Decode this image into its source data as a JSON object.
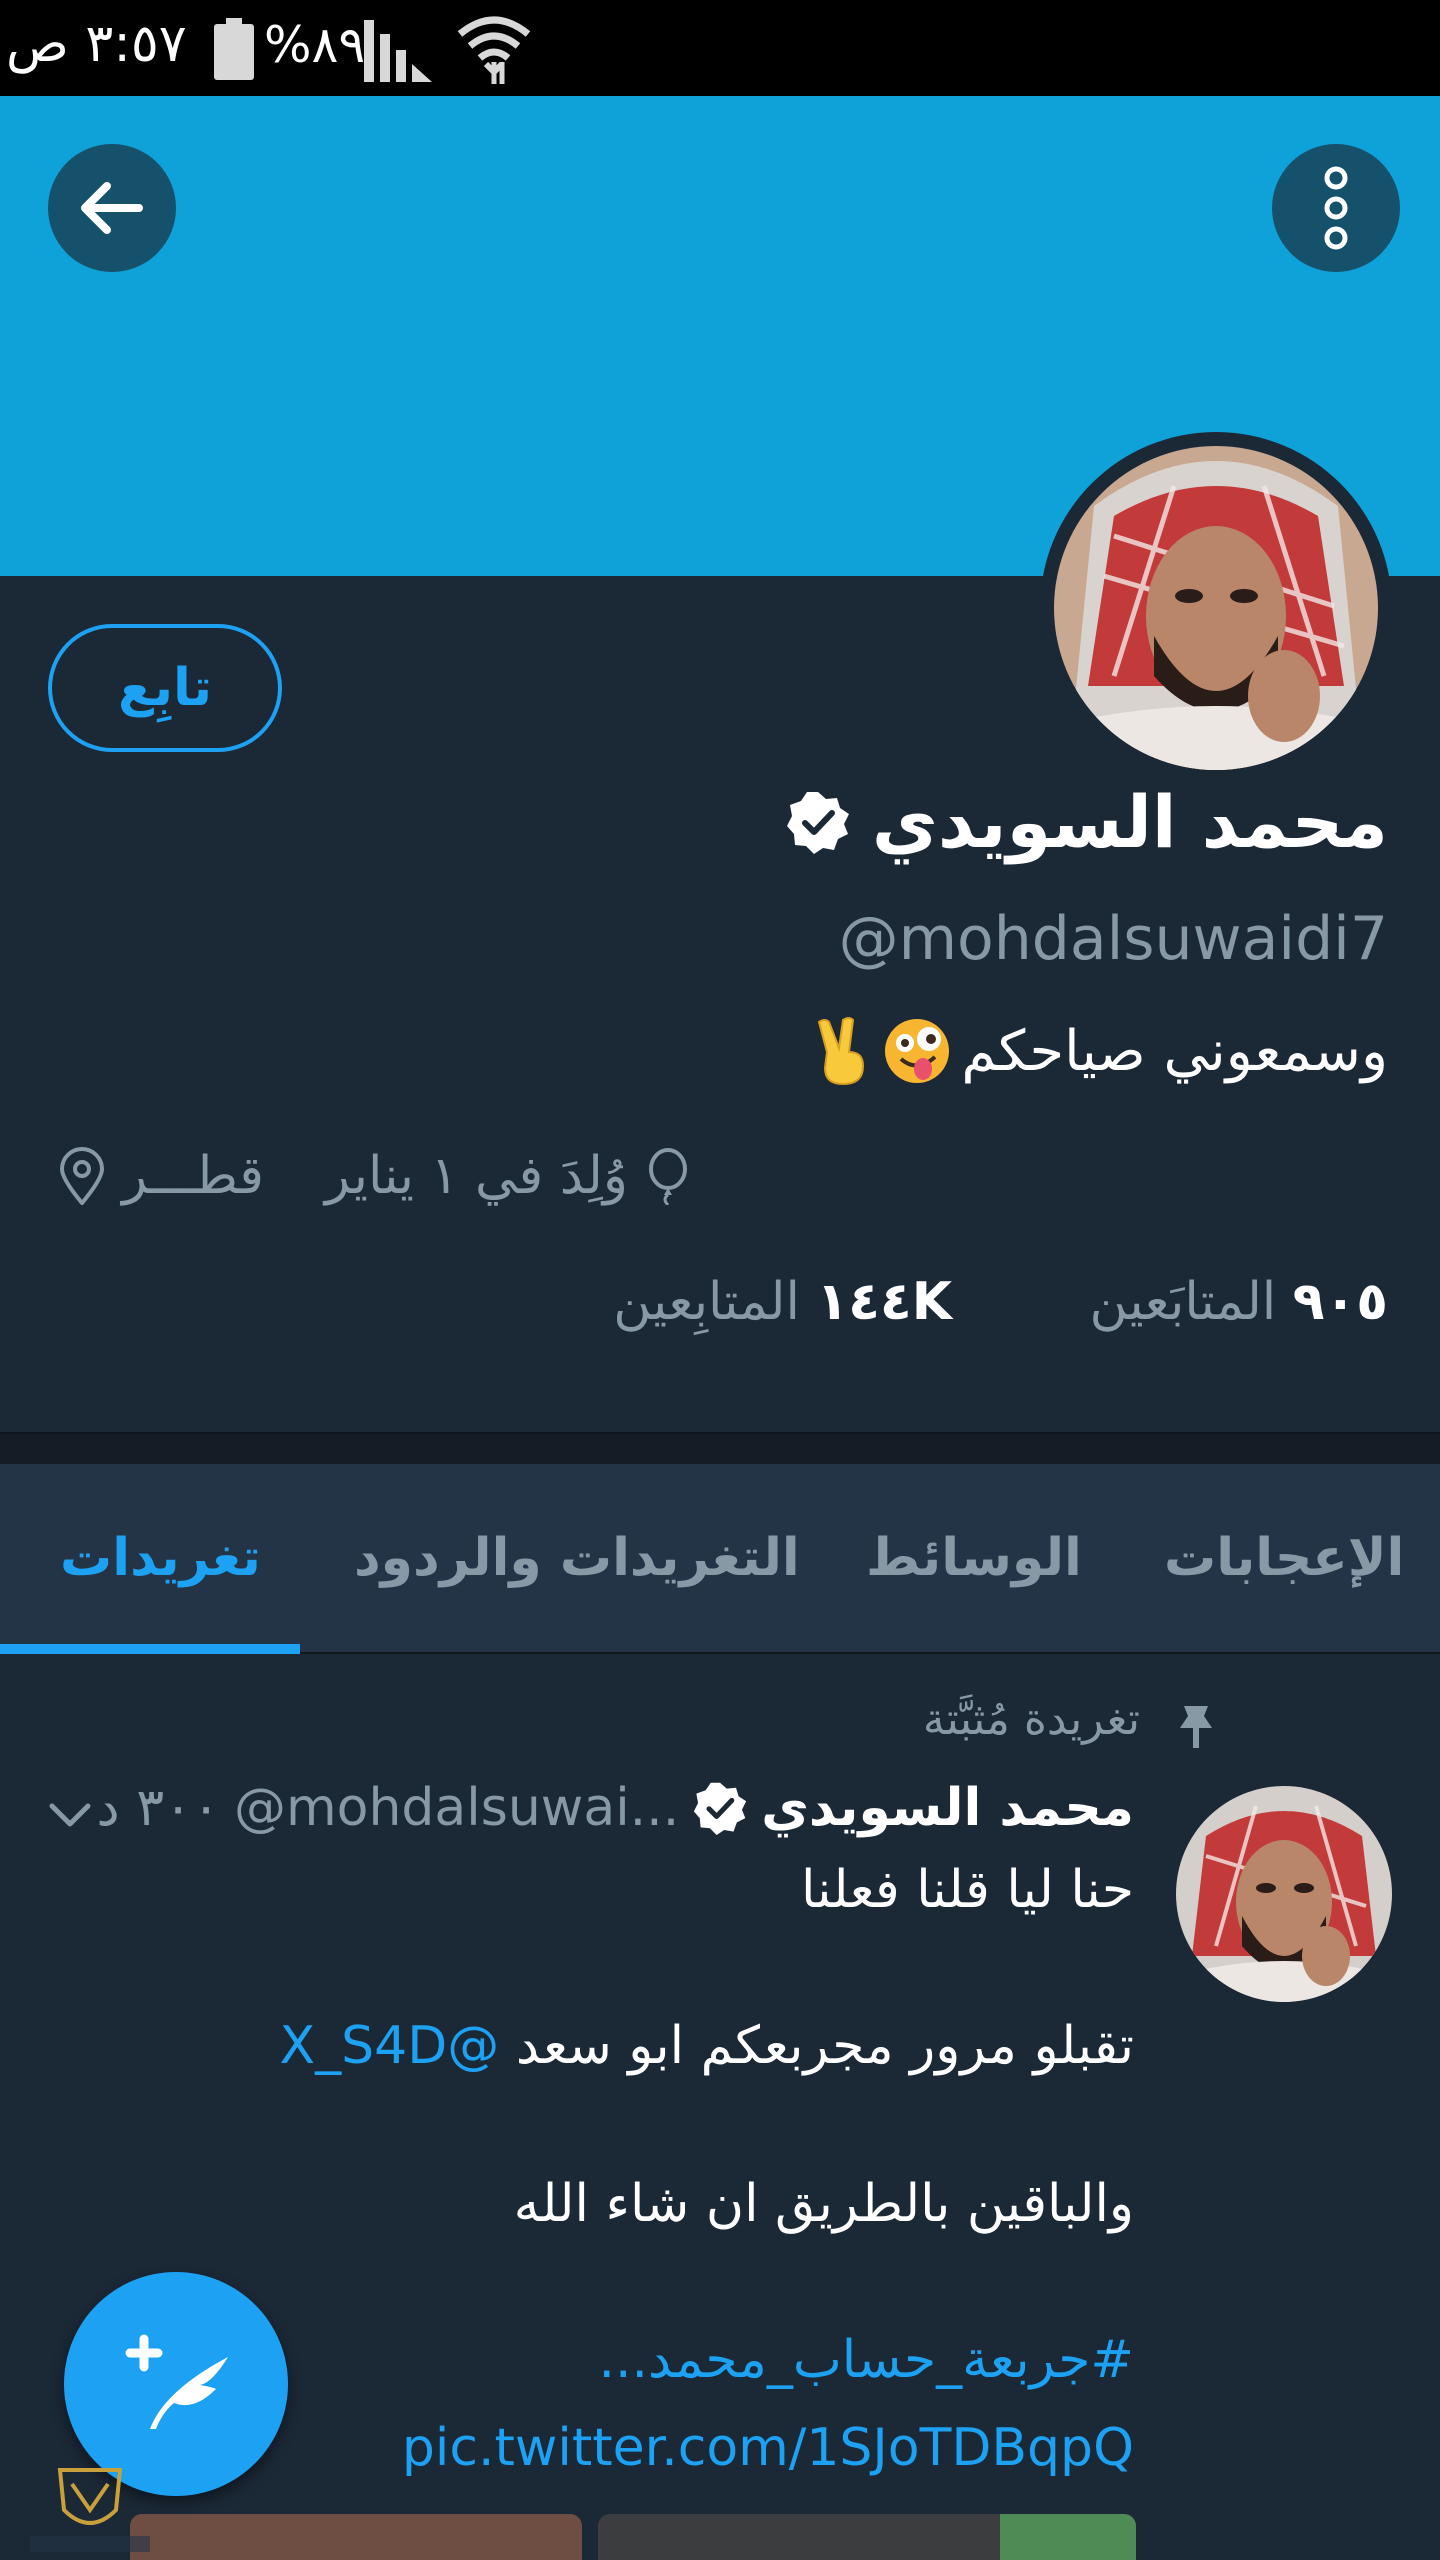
{
  "status_bar": {
    "time": "٣:٥٧ ص",
    "battery": "%٨٩"
  },
  "header": {
    "back_icon": "arrow-left-icon",
    "more_icon": "more-vertical-icon",
    "banner_color": "#0fa2d9"
  },
  "profile": {
    "follow_label": "تابِع",
    "display_name": "محمد السويدي",
    "handle": "@mohdalsuwaidi7",
    "bio": "وسمعوني صياحكم",
    "birthday": "وُلِدَ في ١ يناير",
    "location": "قطـــر",
    "following_count": "٩٠٥",
    "following_label": "المتابَعين",
    "followers_count": "١٤٤K",
    "followers_label": "المتابِعين"
  },
  "tabs": [
    {
      "label": "تغريدات",
      "active": true
    },
    {
      "label": "التغريدات والردود",
      "active": false
    },
    {
      "label": "الوسائط",
      "active": false
    },
    {
      "label": "الإعجابات",
      "active": false
    }
  ],
  "tweet": {
    "pinned_label": "تغريدة مُثبَّتة",
    "name": "محمد السويدي",
    "handle": "@mohdalsuwai...",
    "time": "٣٠٠ د",
    "line1": "حنا ليا قلنا فعلنا",
    "line2_text": "تقبلو مرور مجربعكم ابو سعد",
    "line2_mention": "@X_S4D",
    "line3": "والباقين بالطريق ان شاء الله",
    "line4_hashtag": "#جربعة_حساب_محمد...",
    "line5_link": "pic.twitter.com/1SJoTDBqpQ"
  },
  "colors": {
    "accent": "#1da1f2",
    "background": "#1b2836",
    "tab_bar": "#243447",
    "muted_text": "#8899a6"
  }
}
